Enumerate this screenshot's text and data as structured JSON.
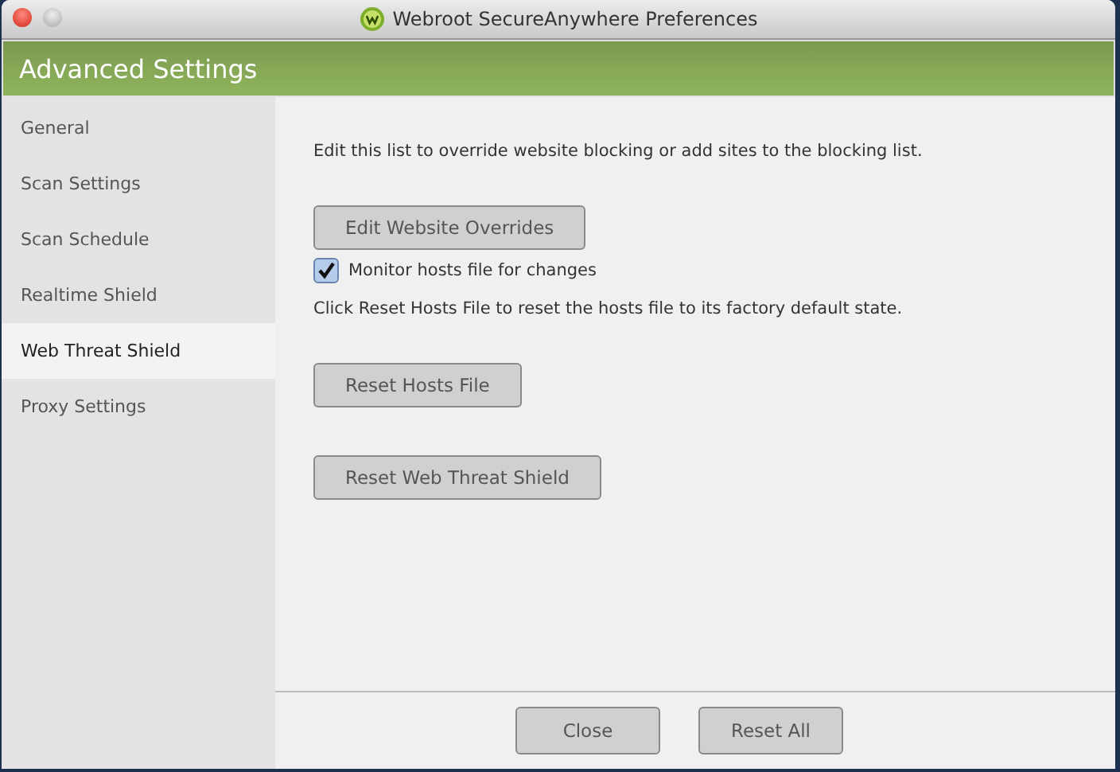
{
  "window": {
    "title": "Webroot SecureAnywhere Preferences"
  },
  "header": {
    "title": "Advanced Settings"
  },
  "sidebar": {
    "items": [
      {
        "label": "General",
        "selected": false
      },
      {
        "label": "Scan Settings",
        "selected": false
      },
      {
        "label": "Scan Schedule",
        "selected": false
      },
      {
        "label": "Realtime Shield",
        "selected": false
      },
      {
        "label": "Web Threat Shield",
        "selected": true
      },
      {
        "label": "Proxy Settings",
        "selected": false
      }
    ]
  },
  "content": [
    {
      "kind": "text",
      "text": "Edit this list to override website blocking or add sites to the blocking list."
    },
    {
      "kind": "button",
      "label": "Edit Website Overrides"
    },
    {
      "kind": "checkbox",
      "label": "Monitor hosts file for changes",
      "checked": true
    },
    {
      "kind": "text",
      "text": "Click Reset Hosts File to reset the hosts file to its factory default state."
    },
    {
      "kind": "button",
      "label": "Reset Hosts File"
    },
    {
      "kind": "button",
      "label": "Reset Web Threat Shield"
    }
  ],
  "footer": {
    "buttons": [
      "Close",
      "Reset All"
    ]
  }
}
